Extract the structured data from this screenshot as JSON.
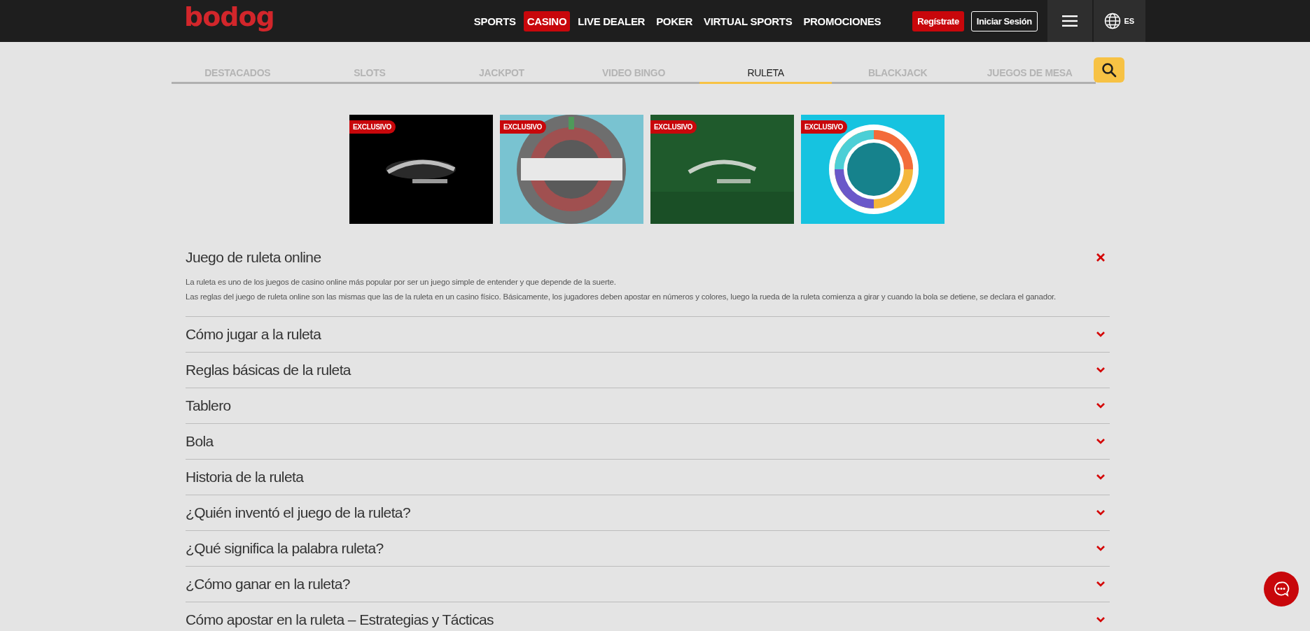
{
  "header": {
    "logo": "bodog",
    "nav": [
      {
        "label": "SPORTS",
        "selected": false
      },
      {
        "label": "CASINO",
        "selected": true
      },
      {
        "label": "LIVE DEALER",
        "selected": false
      },
      {
        "label": "POKER",
        "selected": false
      },
      {
        "label": "VIRTUAL SPORTS",
        "selected": false
      },
      {
        "label": "PROMOCIONES",
        "selected": false
      }
    ],
    "register": "Regístrate",
    "login": "Iniciar Sesión",
    "language": "ES"
  },
  "tabs": [
    {
      "label": "DESTACADOS",
      "selected": false
    },
    {
      "label": "SLOTS",
      "selected": false
    },
    {
      "label": "JACKPOT",
      "selected": false
    },
    {
      "label": "VIDEO BINGO",
      "selected": false
    },
    {
      "label": "RULETA",
      "selected": true
    },
    {
      "label": "BLACKJACK",
      "selected": false
    },
    {
      "label": "JUEGOS DE MESA",
      "selected": false
    }
  ],
  "games": [
    {
      "badge": "EXCLUSIVO"
    },
    {
      "badge": "EXCLUSIVO"
    },
    {
      "badge": "EXCLUSIVO"
    },
    {
      "badge": "EXCLUSIVO"
    }
  ],
  "faq": [
    {
      "title": "Juego de ruleta online",
      "expanded": true,
      "paragraphs": [
        "La ruleta es uno de los juegos de casino online más popular por ser un juego simple de entender y que depende de la suerte.",
        "Las reglas del juego de ruleta online son las mismas que las de la ruleta en un casino físico. Básicamente, los jugadores deben apostar en números y colores, luego la rueda de la ruleta comienza a girar y cuando la bola se detiene, se declara el ganador."
      ]
    },
    {
      "title": "Cómo jugar a la ruleta",
      "expanded": false
    },
    {
      "title": "Reglas básicas de la ruleta",
      "expanded": false
    },
    {
      "title": "Tablero",
      "expanded": false
    },
    {
      "title": "Bola",
      "expanded": false
    },
    {
      "title": "Historia de la ruleta",
      "expanded": false
    },
    {
      "title": "¿Quién inventó el juego de la ruleta?",
      "expanded": false
    },
    {
      "title": "¿Qué significa la palabra ruleta?",
      "expanded": false
    },
    {
      "title": "¿Cómo ganar en la ruleta?",
      "expanded": false
    },
    {
      "title": "Cómo apostar en la ruleta – Estrategias y Tácticas",
      "expanded": false
    }
  ]
}
